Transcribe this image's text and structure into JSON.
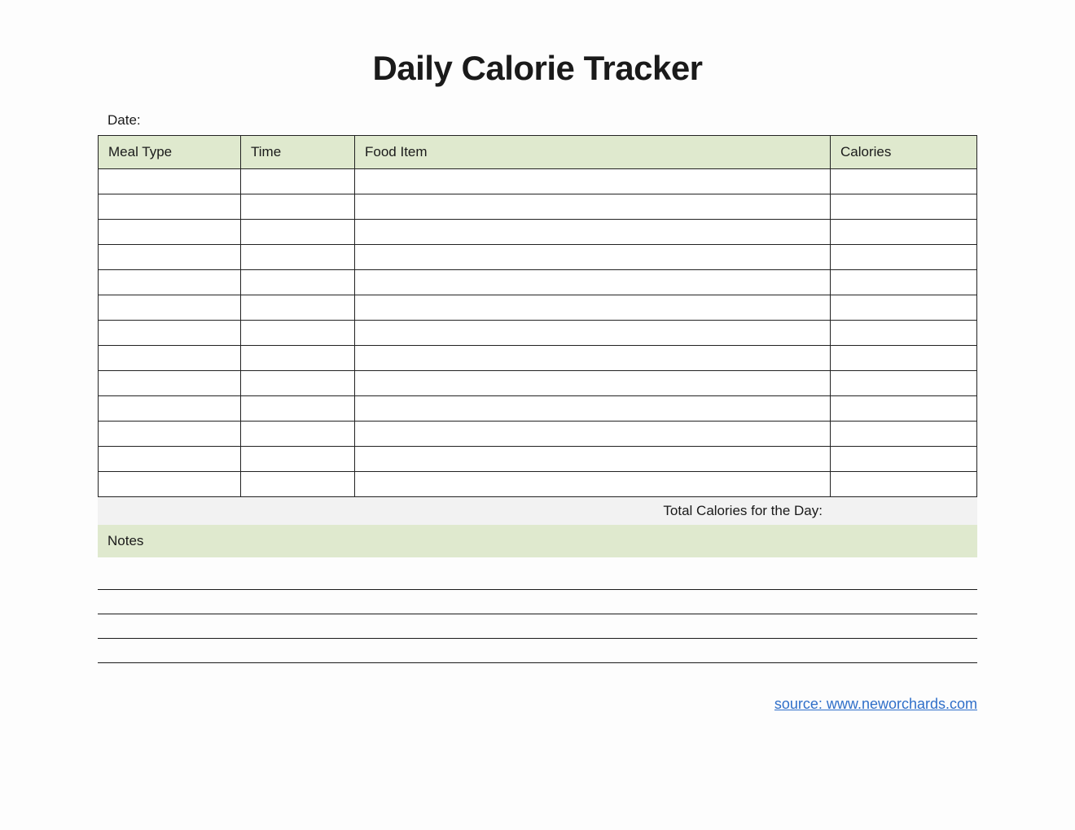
{
  "title": "Daily Calorie Tracker",
  "date_label": "Date:",
  "date_value": "",
  "table": {
    "headers": {
      "meal_type": "Meal Type",
      "time": "Time",
      "food_item": "Food Item",
      "calories": "Calories"
    },
    "rows": [
      {
        "meal_type": "",
        "time": "",
        "food_item": "",
        "calories": ""
      },
      {
        "meal_type": "",
        "time": "",
        "food_item": "",
        "calories": ""
      },
      {
        "meal_type": "",
        "time": "",
        "food_item": "",
        "calories": ""
      },
      {
        "meal_type": "",
        "time": "",
        "food_item": "",
        "calories": ""
      },
      {
        "meal_type": "",
        "time": "",
        "food_item": "",
        "calories": ""
      },
      {
        "meal_type": "",
        "time": "",
        "food_item": "",
        "calories": ""
      },
      {
        "meal_type": "",
        "time": "",
        "food_item": "",
        "calories": ""
      },
      {
        "meal_type": "",
        "time": "",
        "food_item": "",
        "calories": ""
      },
      {
        "meal_type": "",
        "time": "",
        "food_item": "",
        "calories": ""
      },
      {
        "meal_type": "",
        "time": "",
        "food_item": "",
        "calories": ""
      },
      {
        "meal_type": "",
        "time": "",
        "food_item": "",
        "calories": ""
      },
      {
        "meal_type": "",
        "time": "",
        "food_item": "",
        "calories": ""
      },
      {
        "meal_type": "",
        "time": "",
        "food_item": "",
        "calories": ""
      }
    ],
    "total_label": "Total Calories for the Day:",
    "total_value": ""
  },
  "notes": {
    "label": "Notes",
    "line_count": 4,
    "lines": [
      "",
      "",
      "",
      ""
    ]
  },
  "source": {
    "prefix": "source: ",
    "text": "www.neworchards.com",
    "full": "source: www.neworchards.com"
  }
}
